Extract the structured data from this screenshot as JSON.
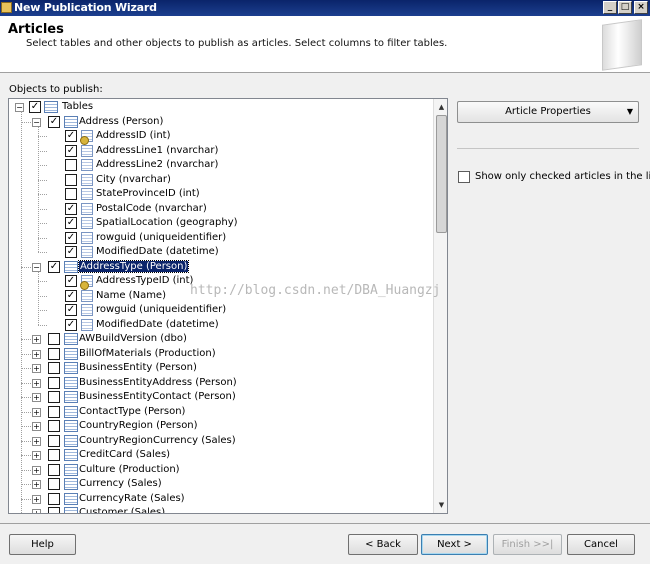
{
  "window": {
    "title": "New Publication Wizard"
  },
  "header": {
    "title": "Articles",
    "description": "Select tables and other objects to publish as articles. Select columns to filter tables."
  },
  "objects_label": "Objects to publish:",
  "tree": {
    "root": {
      "label": "Tables",
      "checked": true
    },
    "rows": [
      {
        "label": "Address (Person)",
        "checked": true,
        "type": "table",
        "expanded": true
      },
      {
        "label": "AddressID (int)",
        "checked": true,
        "type": "key"
      },
      {
        "label": "AddressLine1 (nvarchar)",
        "checked": true,
        "type": "column"
      },
      {
        "label": "AddressLine2 (nvarchar)",
        "checked": false,
        "type": "column"
      },
      {
        "label": "City (nvarchar)",
        "checked": false,
        "type": "column"
      },
      {
        "label": "StateProvinceID (int)",
        "checked": false,
        "type": "column"
      },
      {
        "label": "PostalCode (nvarchar)",
        "checked": true,
        "type": "column"
      },
      {
        "label": "SpatialLocation (geography)",
        "checked": true,
        "type": "column"
      },
      {
        "label": "rowguid (uniqueidentifier)",
        "checked": true,
        "type": "column"
      },
      {
        "label": "ModifiedDate (datetime)",
        "checked": true,
        "type": "column"
      },
      {
        "label": "AddressType (Person)",
        "checked": true,
        "type": "table",
        "expanded": true,
        "selected": true
      },
      {
        "label": "AddressTypeID (int)",
        "checked": true,
        "type": "key"
      },
      {
        "label": "Name (Name)",
        "checked": true,
        "type": "column"
      },
      {
        "label": "rowguid (uniqueidentifier)",
        "checked": true,
        "type": "column"
      },
      {
        "label": "ModifiedDate (datetime)",
        "checked": true,
        "type": "column"
      },
      {
        "label": "AWBuildVersion (dbo)",
        "checked": false,
        "type": "table"
      },
      {
        "label": "BillOfMaterials (Production)",
        "checked": false,
        "type": "table"
      },
      {
        "label": "BusinessEntity (Person)",
        "checked": false,
        "type": "table"
      },
      {
        "label": "BusinessEntityAddress (Person)",
        "checked": false,
        "type": "table"
      },
      {
        "label": "BusinessEntityContact (Person)",
        "checked": false,
        "type": "table"
      },
      {
        "label": "ContactType (Person)",
        "checked": false,
        "type": "table"
      },
      {
        "label": "CountryRegion (Person)",
        "checked": false,
        "type": "table"
      },
      {
        "label": "CountryRegionCurrency (Sales)",
        "checked": false,
        "type": "table"
      },
      {
        "label": "CreditCard (Sales)",
        "checked": false,
        "type": "table"
      },
      {
        "label": "Culture (Production)",
        "checked": false,
        "type": "table"
      },
      {
        "label": "Currency (Sales)",
        "checked": false,
        "type": "table"
      },
      {
        "label": "CurrencyRate (Sales)",
        "checked": false,
        "type": "table"
      },
      {
        "label": "Customer (Sales)",
        "checked": false,
        "type": "table"
      }
    ]
  },
  "article_properties": {
    "label": "Article Properties"
  },
  "show_only": {
    "label": "Show only checked articles in the list",
    "checked": false
  },
  "watermark": "http://blog.csdn.net/DBA_Huangzj",
  "buttons": {
    "help": "Help",
    "back": "< Back",
    "next": "Next >",
    "finish": "Finish >>|",
    "cancel": "Cancel"
  },
  "icons": {
    "app": "wizard-icon",
    "table": "table-icon",
    "column": "column-icon",
    "key": "primary-key-icon"
  }
}
